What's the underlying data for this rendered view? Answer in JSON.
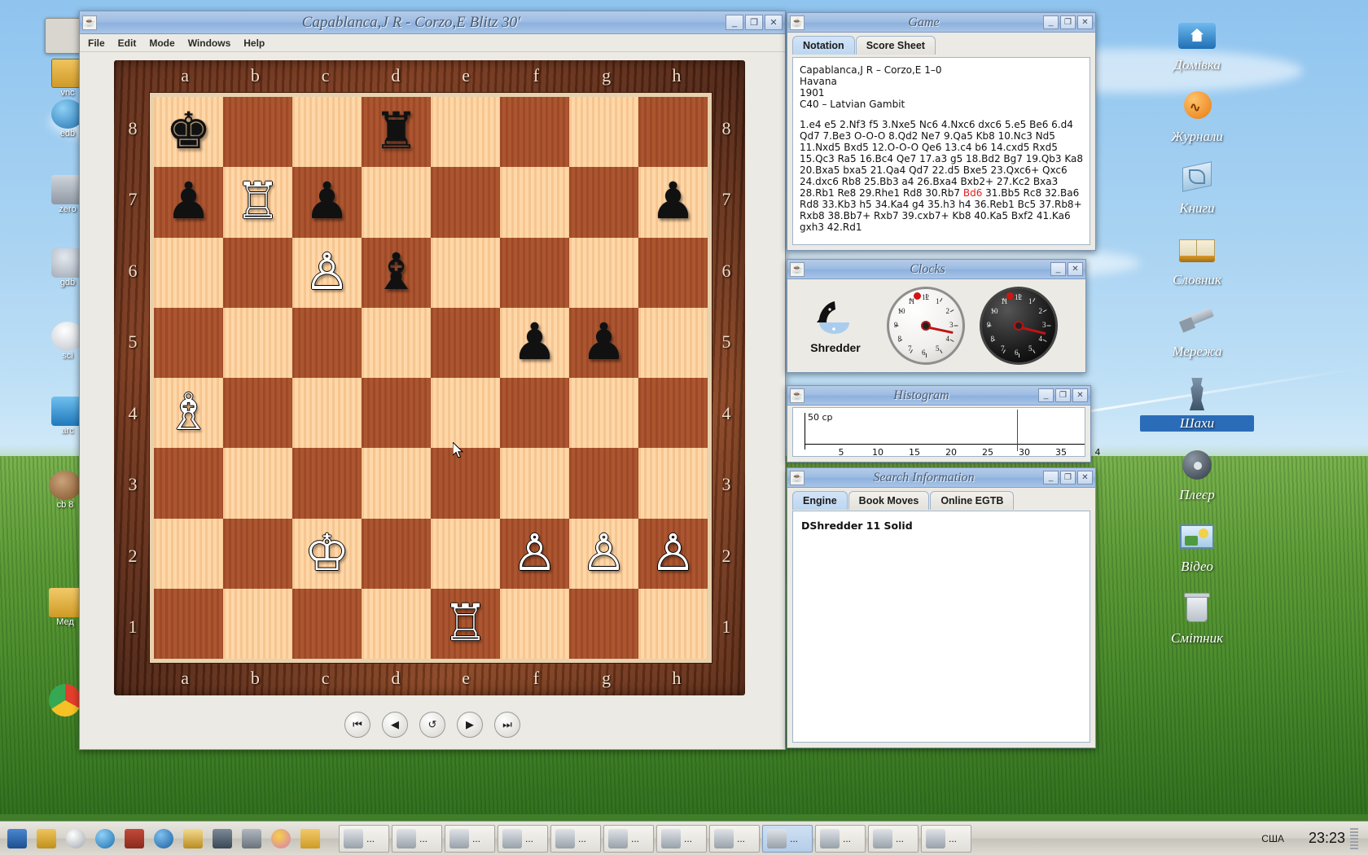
{
  "desktop": {
    "icons": [
      {
        "label": "Домівка",
        "icon": "home-folder-icon"
      },
      {
        "label": "Журнали",
        "icon": "magazines-icon"
      },
      {
        "label": "Книги",
        "icon": "books-icon"
      },
      {
        "label": "Словник",
        "icon": "dictionary-icon"
      },
      {
        "label": "Мережа",
        "icon": "network-icon"
      },
      {
        "label": "Шахи",
        "icon": "chess-icon"
      },
      {
        "label": "Плеєр",
        "icon": "player-icon"
      },
      {
        "label": "Відео",
        "icon": "video-icon"
      },
      {
        "label": "Смітник",
        "icon": "trash-icon"
      }
    ],
    "left_icons": [
      {
        "label": "vnc"
      },
      {
        "label": "edb"
      },
      {
        "label": "zero"
      },
      {
        "label": "gdb"
      },
      {
        "label": "sci"
      },
      {
        "label": "arc"
      },
      {
        "label": "cb 8"
      },
      {
        "label": "Мед"
      }
    ]
  },
  "chess_window": {
    "title": "Capablanca,J R - Corzo,E   Blitz 30'",
    "menu": [
      "File",
      "Edit",
      "Mode",
      "Windows",
      "Help"
    ],
    "window_buttons": {
      "minimize": "_",
      "maximize": "❐",
      "close": "✕"
    },
    "files": [
      "a",
      "b",
      "c",
      "d",
      "e",
      "f",
      "g",
      "h"
    ],
    "ranks": [
      "8",
      "7",
      "6",
      "5",
      "4",
      "3",
      "2",
      "1"
    ],
    "nav_buttons": [
      {
        "name": "first-move-button",
        "glyph": "⏮"
      },
      {
        "name": "previous-move-button",
        "glyph": "◀"
      },
      {
        "name": "undo-button",
        "glyph": "↺"
      },
      {
        "name": "next-move-button",
        "glyph": "▶"
      },
      {
        "name": "last-move-button",
        "glyph": "⏭"
      }
    ],
    "position": [
      [
        "bk",
        "",
        "",
        "br",
        "",
        "",
        "",
        ""
      ],
      [
        "bp",
        "wr",
        "bp",
        "",
        "",
        "",
        "",
        "bp"
      ],
      [
        "",
        "",
        "wp",
        "bb",
        "",
        "",
        "",
        ""
      ],
      [
        "",
        "",
        "",
        "",
        "",
        "bp",
        "bp",
        ""
      ],
      [
        "wb",
        "",
        "",
        "",
        "",
        "",
        "",
        ""
      ],
      [
        "",
        "",
        "",
        "",
        "",
        "",
        "",
        ""
      ],
      [
        "",
        "",
        "wk",
        "",
        "",
        "wp",
        "wp",
        "wp"
      ],
      [
        "",
        "",
        "",
        "",
        "wr",
        "",
        "",
        ""
      ]
    ],
    "glyphs": {
      "wk": "♔",
      "wq": "♕",
      "wr": "♖",
      "wb": "♗",
      "wn": "♘",
      "wp": "♙",
      "bk": "♚",
      "bq": "♛",
      "br": "♜",
      "bb": "♝",
      "bn": "♞",
      "bp": "♟"
    }
  },
  "game_window": {
    "title": "Game",
    "tabs": [
      {
        "label": "Notation",
        "active": true
      },
      {
        "label": "Score Sheet",
        "active": false
      }
    ],
    "header": {
      "players": "Capablanca,J R – Corzo,E 1–0",
      "site": "Havana",
      "year": "1901",
      "opening": "C40 – Latvian Gambit"
    },
    "moves_before": "1.e4 e5 2.Nf3 f5 3.Nxe5 Nc6 4.Nxc6 dxc6 5.e5 Be6 6.d4 Qd7 7.Be3 O-O-O 8.Qd2 Ne7 9.Qa5 Kb8 10.Nc3 Nd5 11.Nxd5 Bxd5 12.O-O-O Qe6 13.c4 b6 14.cxd5 Rxd5 15.Qc3 Ra5 16.Bc4 Qe7 17.a3 g5 18.Bd2 Bg7 19.Qb3 Ka8 20.Bxa5 bxa5 21.Qa4 Qd7 22.d5 Bxe5 23.Qxc6+ Qxc6 24.dxc6 Rb8 25.Bb3 a4 26.Bxa4 Bxb2+ 27.Kc2 Bxa3 28.Rb1 Re8 29.Rhe1 Rd8 30.Rb7 ",
    "move_highlight": "Bd6",
    "moves_after": " 31.Bb5 Rc8 32.Ba6 Rd8 33.Kb3 h5 34.Ka4 g4 35.h3 h4 36.Reb1 Bc5 37.Rb8+ Rxb8 38.Bb7+ Rxb7 39.cxb7+ Kb8 40.Ka5 Bxf2 41.Ka6 gxh3 42.Rd1"
  },
  "clocks_window": {
    "title": "Clocks",
    "engine_label": "Shredder",
    "dial_numbers": [
      "12",
      "1",
      "2",
      "3",
      "4",
      "5",
      "6",
      "7",
      "8",
      "9",
      "10",
      "11"
    ]
  },
  "histogram_window": {
    "title": "Histogram",
    "y_label": "50 cp",
    "x_ticks": [
      "5",
      "10",
      "15",
      "20",
      "25",
      "30",
      "35",
      "4"
    ],
    "marker_color": "#d01414"
  },
  "search_window": {
    "title": "Search Information",
    "tabs": [
      {
        "label": "Engine",
        "active": true
      },
      {
        "label": "Book Moves",
        "active": false
      },
      {
        "label": "Online EGTB",
        "active": false
      }
    ],
    "engine_name": "DShredder 11 Solid"
  },
  "taskbar": {
    "items": [
      "...",
      "...",
      "...",
      "...",
      "...",
      "...",
      "...",
      "...",
      "...",
      "...",
      "...",
      "..."
    ],
    "active_index": 8,
    "language": "США",
    "clock": "23:23"
  }
}
